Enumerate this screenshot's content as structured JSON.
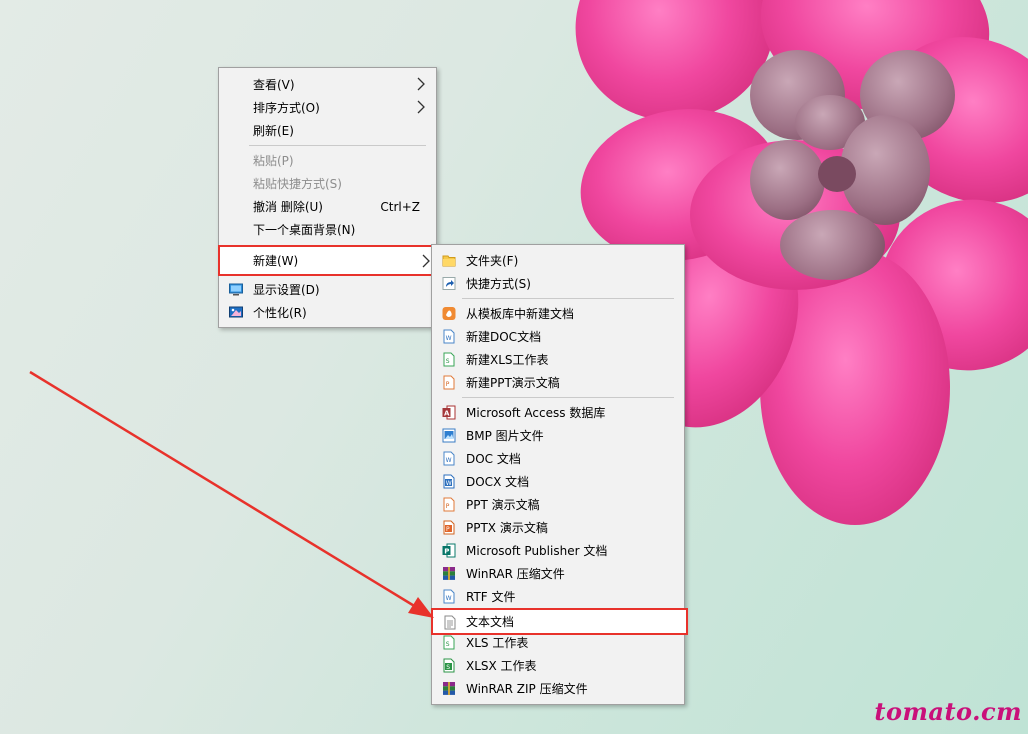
{
  "context_menu": {
    "items": [
      {
        "label": "查看(V)",
        "has_submenu": true
      },
      {
        "label": "排序方式(O)",
        "has_submenu": true
      },
      {
        "label": "刷新(E)"
      },
      {
        "label": "粘贴(P)",
        "disabled": true
      },
      {
        "label": "粘贴快捷方式(S)",
        "disabled": true
      },
      {
        "label": "撤消 删除(U)",
        "shortcut": "Ctrl+Z"
      },
      {
        "label": "下一个桌面背景(N)"
      },
      {
        "label": "新建(W)",
        "has_submenu": true,
        "highlighted": true
      },
      {
        "label": "显示设置(D)",
        "icon": "display-settings-icon"
      },
      {
        "label": "个性化(R)",
        "icon": "personalize-icon"
      }
    ]
  },
  "new_submenu": {
    "items": [
      {
        "label": "文件夹(F)",
        "icon": "folder-icon"
      },
      {
        "label": "快捷方式(S)",
        "icon": "shortcut-icon"
      },
      {
        "label": "从模板库中新建文档",
        "icon": "template-icon"
      },
      {
        "label": "新建DOC文档",
        "icon": "doc-icon"
      },
      {
        "label": "新建XLS工作表",
        "icon": "xls-icon"
      },
      {
        "label": "新建PPT演示文稿",
        "icon": "ppt-icon"
      },
      {
        "label": "Microsoft Access 数据库",
        "icon": "access-icon"
      },
      {
        "label": "BMP 图片文件",
        "icon": "bmp-icon"
      },
      {
        "label": "DOC 文档",
        "icon": "doc-icon"
      },
      {
        "label": "DOCX 文档",
        "icon": "docx-icon"
      },
      {
        "label": "PPT 演示文稿",
        "icon": "ppt-icon"
      },
      {
        "label": "PPTX 演示文稿",
        "icon": "pptx-icon"
      },
      {
        "label": "Microsoft Publisher 文档",
        "icon": "publisher-icon"
      },
      {
        "label": "WinRAR 压缩文件",
        "icon": "winrar-icon"
      },
      {
        "label": "RTF 文件",
        "icon": "rtf-icon"
      },
      {
        "label": "文本文档",
        "icon": "text-document-icon",
        "highlighted": true
      },
      {
        "label": "XLS 工作表",
        "icon": "xls-icon"
      },
      {
        "label": "XLSX 工作表",
        "icon": "xlsx-icon"
      },
      {
        "label": "WinRAR ZIP 压缩文件",
        "icon": "winrar-zip-icon"
      }
    ]
  },
  "annotation": {
    "color": "#e8322b"
  },
  "watermark": {
    "text": "tomato.cm",
    "color": "#c9107a"
  }
}
